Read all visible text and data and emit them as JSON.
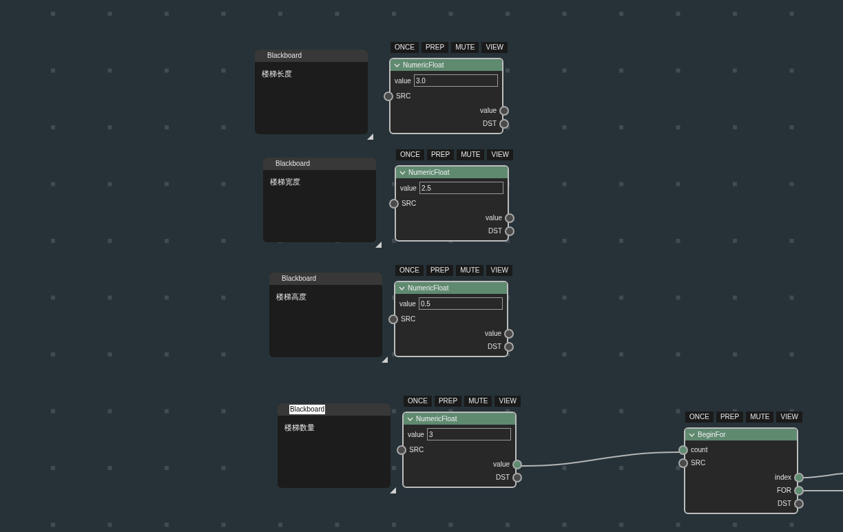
{
  "blackboards": [
    {
      "title": "Blackboard",
      "title_selected": false,
      "text": "楼梯长度"
    },
    {
      "title": "Blackboard",
      "title_selected": false,
      "text": "楼梯宽度"
    },
    {
      "title": "Blackboard",
      "title_selected": false,
      "text": "楼梯高度"
    },
    {
      "title": "Blackboard",
      "title_selected": true,
      "text": "楼梯数量"
    }
  ],
  "nodes": [
    {
      "buttons": [
        "ONCE",
        "PREP",
        "MUTE",
        "VIEW"
      ],
      "title": "NumericFloat",
      "fields": [
        {
          "label": "value",
          "value": "3.0"
        }
      ],
      "inputs": [
        {
          "label": "SRC",
          "connected": false
        }
      ],
      "outputs": [
        {
          "label": "value",
          "connected": false
        },
        {
          "label": "DST",
          "connected": false
        }
      ]
    },
    {
      "buttons": [
        "ONCE",
        "PREP",
        "MUTE",
        "VIEW"
      ],
      "title": "NumericFloat",
      "fields": [
        {
          "label": "value",
          "value": "2.5"
        }
      ],
      "inputs": [
        {
          "label": "SRC",
          "connected": false
        }
      ],
      "outputs": [
        {
          "label": "value",
          "connected": false
        },
        {
          "label": "DST",
          "connected": false
        }
      ]
    },
    {
      "buttons": [
        "ONCE",
        "PREP",
        "MUTE",
        "VIEW"
      ],
      "title": "NumericFloat",
      "fields": [
        {
          "label": "value",
          "value": "0.5"
        }
      ],
      "inputs": [
        {
          "label": "SRC",
          "connected": false
        }
      ],
      "outputs": [
        {
          "label": "value",
          "connected": false
        },
        {
          "label": "DST",
          "connected": false
        }
      ]
    },
    {
      "buttons": [
        "ONCE",
        "PREP",
        "MUTE",
        "VIEW"
      ],
      "title": "NumericFloat",
      "fields": [
        {
          "label": "value",
          "value": "3"
        }
      ],
      "inputs": [
        {
          "label": "SRC",
          "connected": false
        }
      ],
      "outputs": [
        {
          "label": "value",
          "connected": true
        },
        {
          "label": "DST",
          "connected": false
        }
      ]
    },
    {
      "buttons": [
        "ONCE",
        "PREP",
        "MUTE",
        "VIEW"
      ],
      "title": "BeginFor",
      "inputs": [
        {
          "label": "count",
          "connected": true
        },
        {
          "label": "SRC",
          "connected": false
        }
      ],
      "outputs": [
        {
          "label": "index",
          "connected": true
        },
        {
          "label": "FOR",
          "connected": true
        },
        {
          "label": "DST",
          "connected": false
        }
      ]
    }
  ]
}
